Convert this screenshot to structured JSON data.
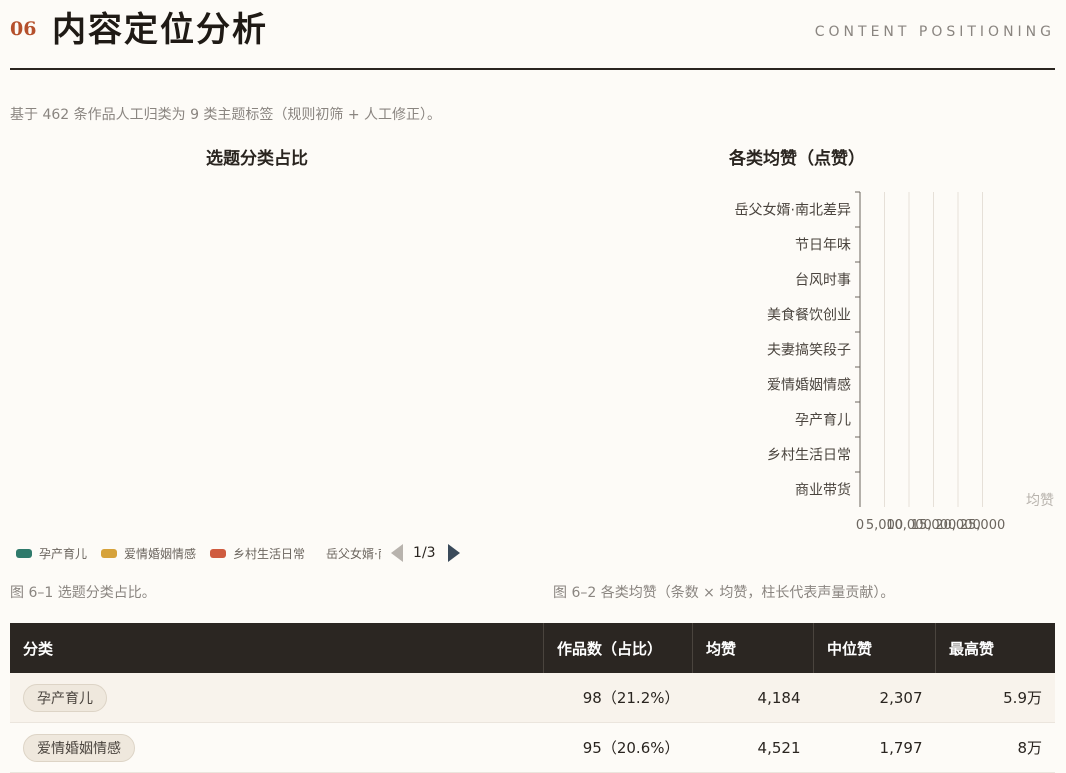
{
  "header": {
    "section_number": "06",
    "title": "内容定位分析",
    "english_title": "CONTENT POSITIONING"
  },
  "intro": "基于 462 条作品人工归类为 9 类主题标签（规则初筛 + 人工修正）。",
  "pie": {
    "title": "选题分类占比",
    "legend": [
      {
        "label": "孕产育儿",
        "color": "#2f7a6b"
      },
      {
        "label": "爱情婚姻情感",
        "color": "#d6a23a"
      },
      {
        "label": "乡村生活日常",
        "color": "#cf5b3f"
      },
      {
        "label": "岳父女婿·南北差异",
        "color": "#4a82bf"
      }
    ],
    "pager": "1/3",
    "caption": "图 6–1 选题分类占比。"
  },
  "bar": {
    "title": "各类均赞（点赞）",
    "caption": "图 6–2 各类均赞（条数 × 均赞，柱长代表声量贡献）。"
  },
  "chart_data": {
    "type": "bar",
    "orientation": "horizontal",
    "categories": [
      "岳父女婿·南北差异",
      "节日年味",
      "台风时事",
      "美食餐饮创业",
      "夫妻搞笑段子",
      "爱情婚姻情感",
      "孕产育儿",
      "乡村生活日常",
      "商业带货"
    ],
    "values": [],
    "xlabel": "均赞",
    "tick_labels": [
      "0",
      "5,000",
      "10,000",
      "15,000",
      "20,000",
      "25,000"
    ],
    "xlim": [
      0,
      25000
    ],
    "grid": true
  },
  "table": {
    "headers": [
      "分类",
      "作品数（占比）",
      "均赞",
      "中位赞",
      "最高赞"
    ],
    "rows": [
      {
        "category": "孕产育儿",
        "count": "98（21.2%）",
        "avg": "4,184",
        "median": "2,307",
        "max": "5.9万"
      },
      {
        "category": "爱情婚姻情感",
        "count": "95（20.6%）",
        "avg": "4,521",
        "median": "1,797",
        "max": "8万"
      }
    ]
  }
}
